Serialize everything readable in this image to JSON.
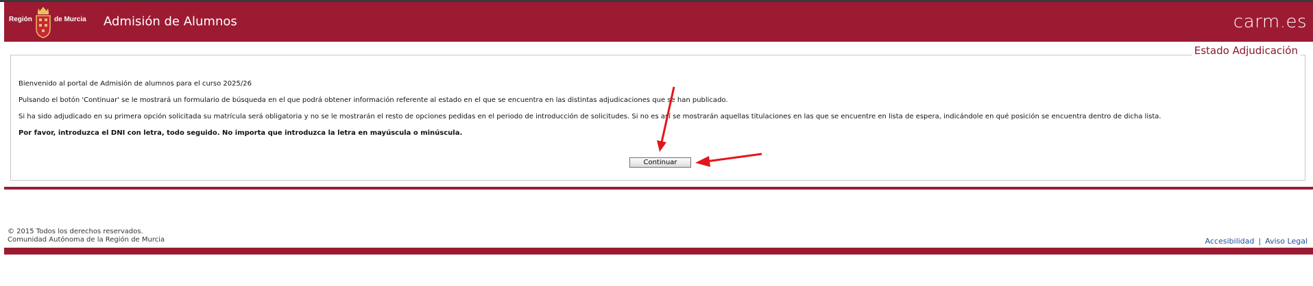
{
  "header": {
    "logo_left": "Región",
    "logo_right": "de Murcia",
    "title": "Admisión de Alumnos",
    "carm_logo": "carm.es",
    "crest_icon": "coat-of-arms-icon"
  },
  "section": {
    "title": "Estado Adjudicación"
  },
  "content": {
    "p1": "Bienvenido al portal de Admisión de alumnos para el curso 2025/26",
    "p2": "Pulsando el botón 'Continuar' se le mostrará un formulario de búsqueda en el que podrá obtener información referente al estado en el que se encuentra en las distintas adjudicaciones que se han publicado.",
    "p3": "Si ha sido adjudicado en su primera opción solicitada su matrícula será obligatoria y no se le mostrarán el resto de opciones pedidas en el periodo de introducción de solicitudes. Si no es así se mostrarán aquellas titulaciones en las que se encuentre en lista de espera, indicándole en qué posición se encuentra dentro de dicha lista.",
    "p4": "Por favor, introduzca el DNI con letra, todo seguido. No importa que introduzca la letra en mayúscula o minúscula."
  },
  "actions": {
    "continue_label": "Continuar"
  },
  "footer": {
    "copyright": "© 2015 Todos los derechos reservados.",
    "organization": "Comunidad Autónoma de la Región de Murcia",
    "link_accessibility": "Accesibilidad",
    "separator": "|",
    "link_legal": "Aviso Legal"
  },
  "colors": {
    "brand": "#9c1b33",
    "section_title": "#8c1530",
    "link": "#1f4e9b",
    "annotation_arrow": "#e3151c"
  }
}
